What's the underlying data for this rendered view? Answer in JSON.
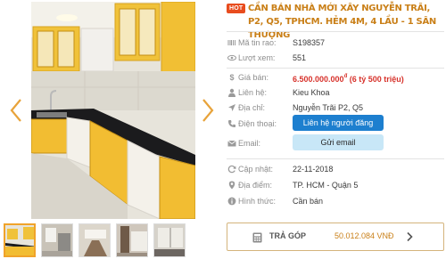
{
  "listing": {
    "hot_badge": "HOT",
    "title": "CẦN BÁN NHÀ MỚI XÂY NGUYỄN TRÃI, P2, Q5, TPHCM. HẺM 4M, 4 LẦU - 1 SÂN THƯỢNG"
  },
  "details": {
    "code_label": "Mã tin rao:",
    "code_value": "S198357",
    "views_label": "Lượt xem:",
    "views_value": "551",
    "price_label": "Giá bán:",
    "price_value": "6.500.000.000",
    "price_currency": "đ",
    "price_words": "(6 tỷ 500 triệu)",
    "contact_label": "Liên hệ:",
    "contact_value": "Kieu Khoa",
    "address_label": "Địa chỉ:",
    "address_value": "Nguyễn Trãi P2, Q5",
    "phone_label": "Điện thoại:",
    "phone_button": "Liên hệ người đăng",
    "email_label": "Email:",
    "email_button": "Gửi email",
    "updated_label": "Cập nhật:",
    "updated_value": "22-11-2018",
    "location_label": "Địa điểm:",
    "location_value": "TP. HCM - Quận 5",
    "type_label": "Hình thức:",
    "type_value": "Cần bán"
  },
  "installment": {
    "label": "TRẢ GÓP",
    "value": "50.012.084 VNĐ"
  },
  "colors": {
    "accent": "#c97f17",
    "price": "#d7322b",
    "hot": "#e84c1e",
    "contact_button": "#1d7fcf",
    "email_button": "#c8e7f7"
  },
  "icons": {
    "prev": "chevron-left-icon",
    "next": "chevron-right-icon",
    "code": "barcode-icon",
    "views": "eye-icon",
    "price": "dollar-icon",
    "contact": "user-icon",
    "address": "location-arrow-icon",
    "phone": "phone-icon",
    "email": "envelope-icon",
    "updated": "refresh-icon",
    "location": "map-marker-icon",
    "type": "info-icon",
    "installment": "calculator-icon"
  }
}
